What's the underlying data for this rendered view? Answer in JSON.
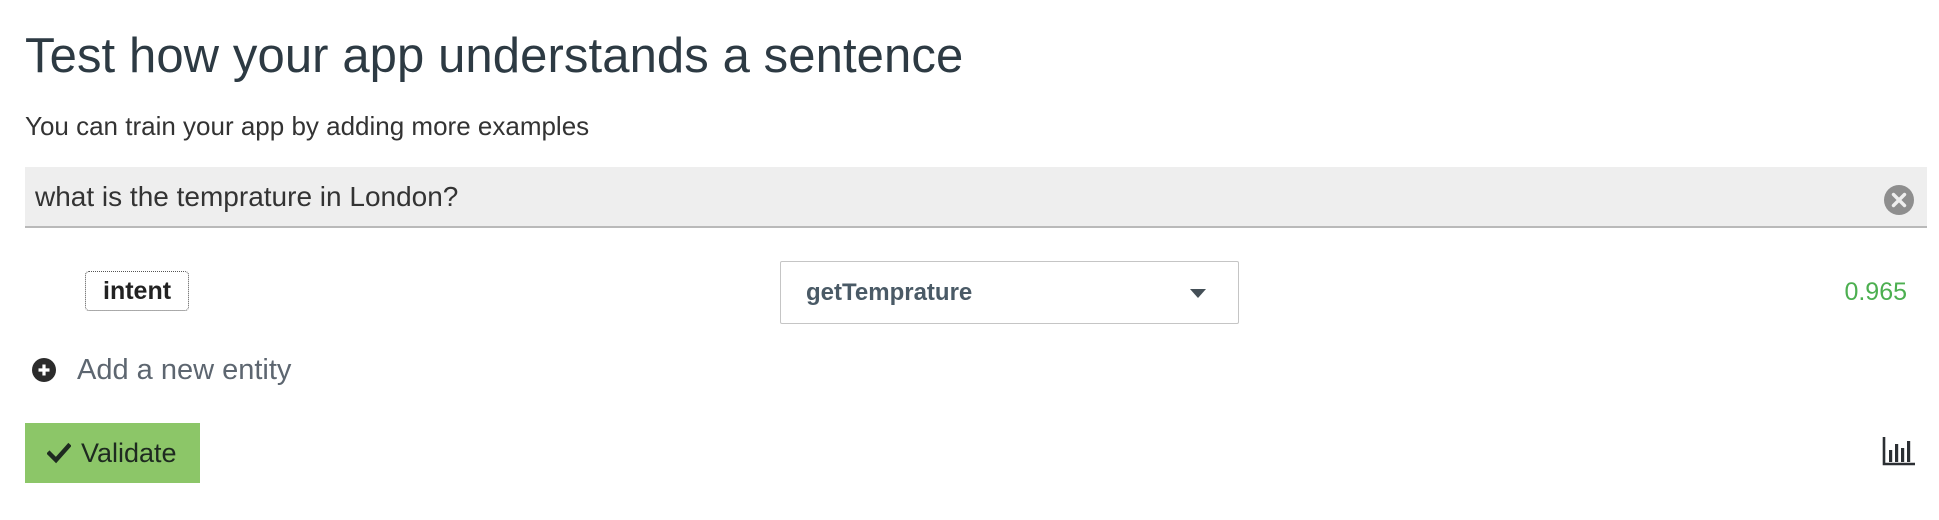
{
  "header": {
    "title": "Test how your app understands a sentence",
    "subtitle": "You can train your app by adding more examples"
  },
  "sentence": {
    "value": "what is the temprature in London?",
    "clear_icon": "close-circle-icon"
  },
  "prediction": {
    "entity_label": "intent",
    "intent_value": "getTemprature",
    "dropdown_icon": "caret-down-icon",
    "confidence": "0.965",
    "confidence_color": "#4caf50"
  },
  "add_entity": {
    "label": "Add a new entity",
    "icon": "plus-circle-icon"
  },
  "actions": {
    "validate_label": "Validate",
    "validate_icon": "check-icon",
    "validate_color": "#8cc668",
    "stats_icon": "bar-chart-icon"
  }
}
